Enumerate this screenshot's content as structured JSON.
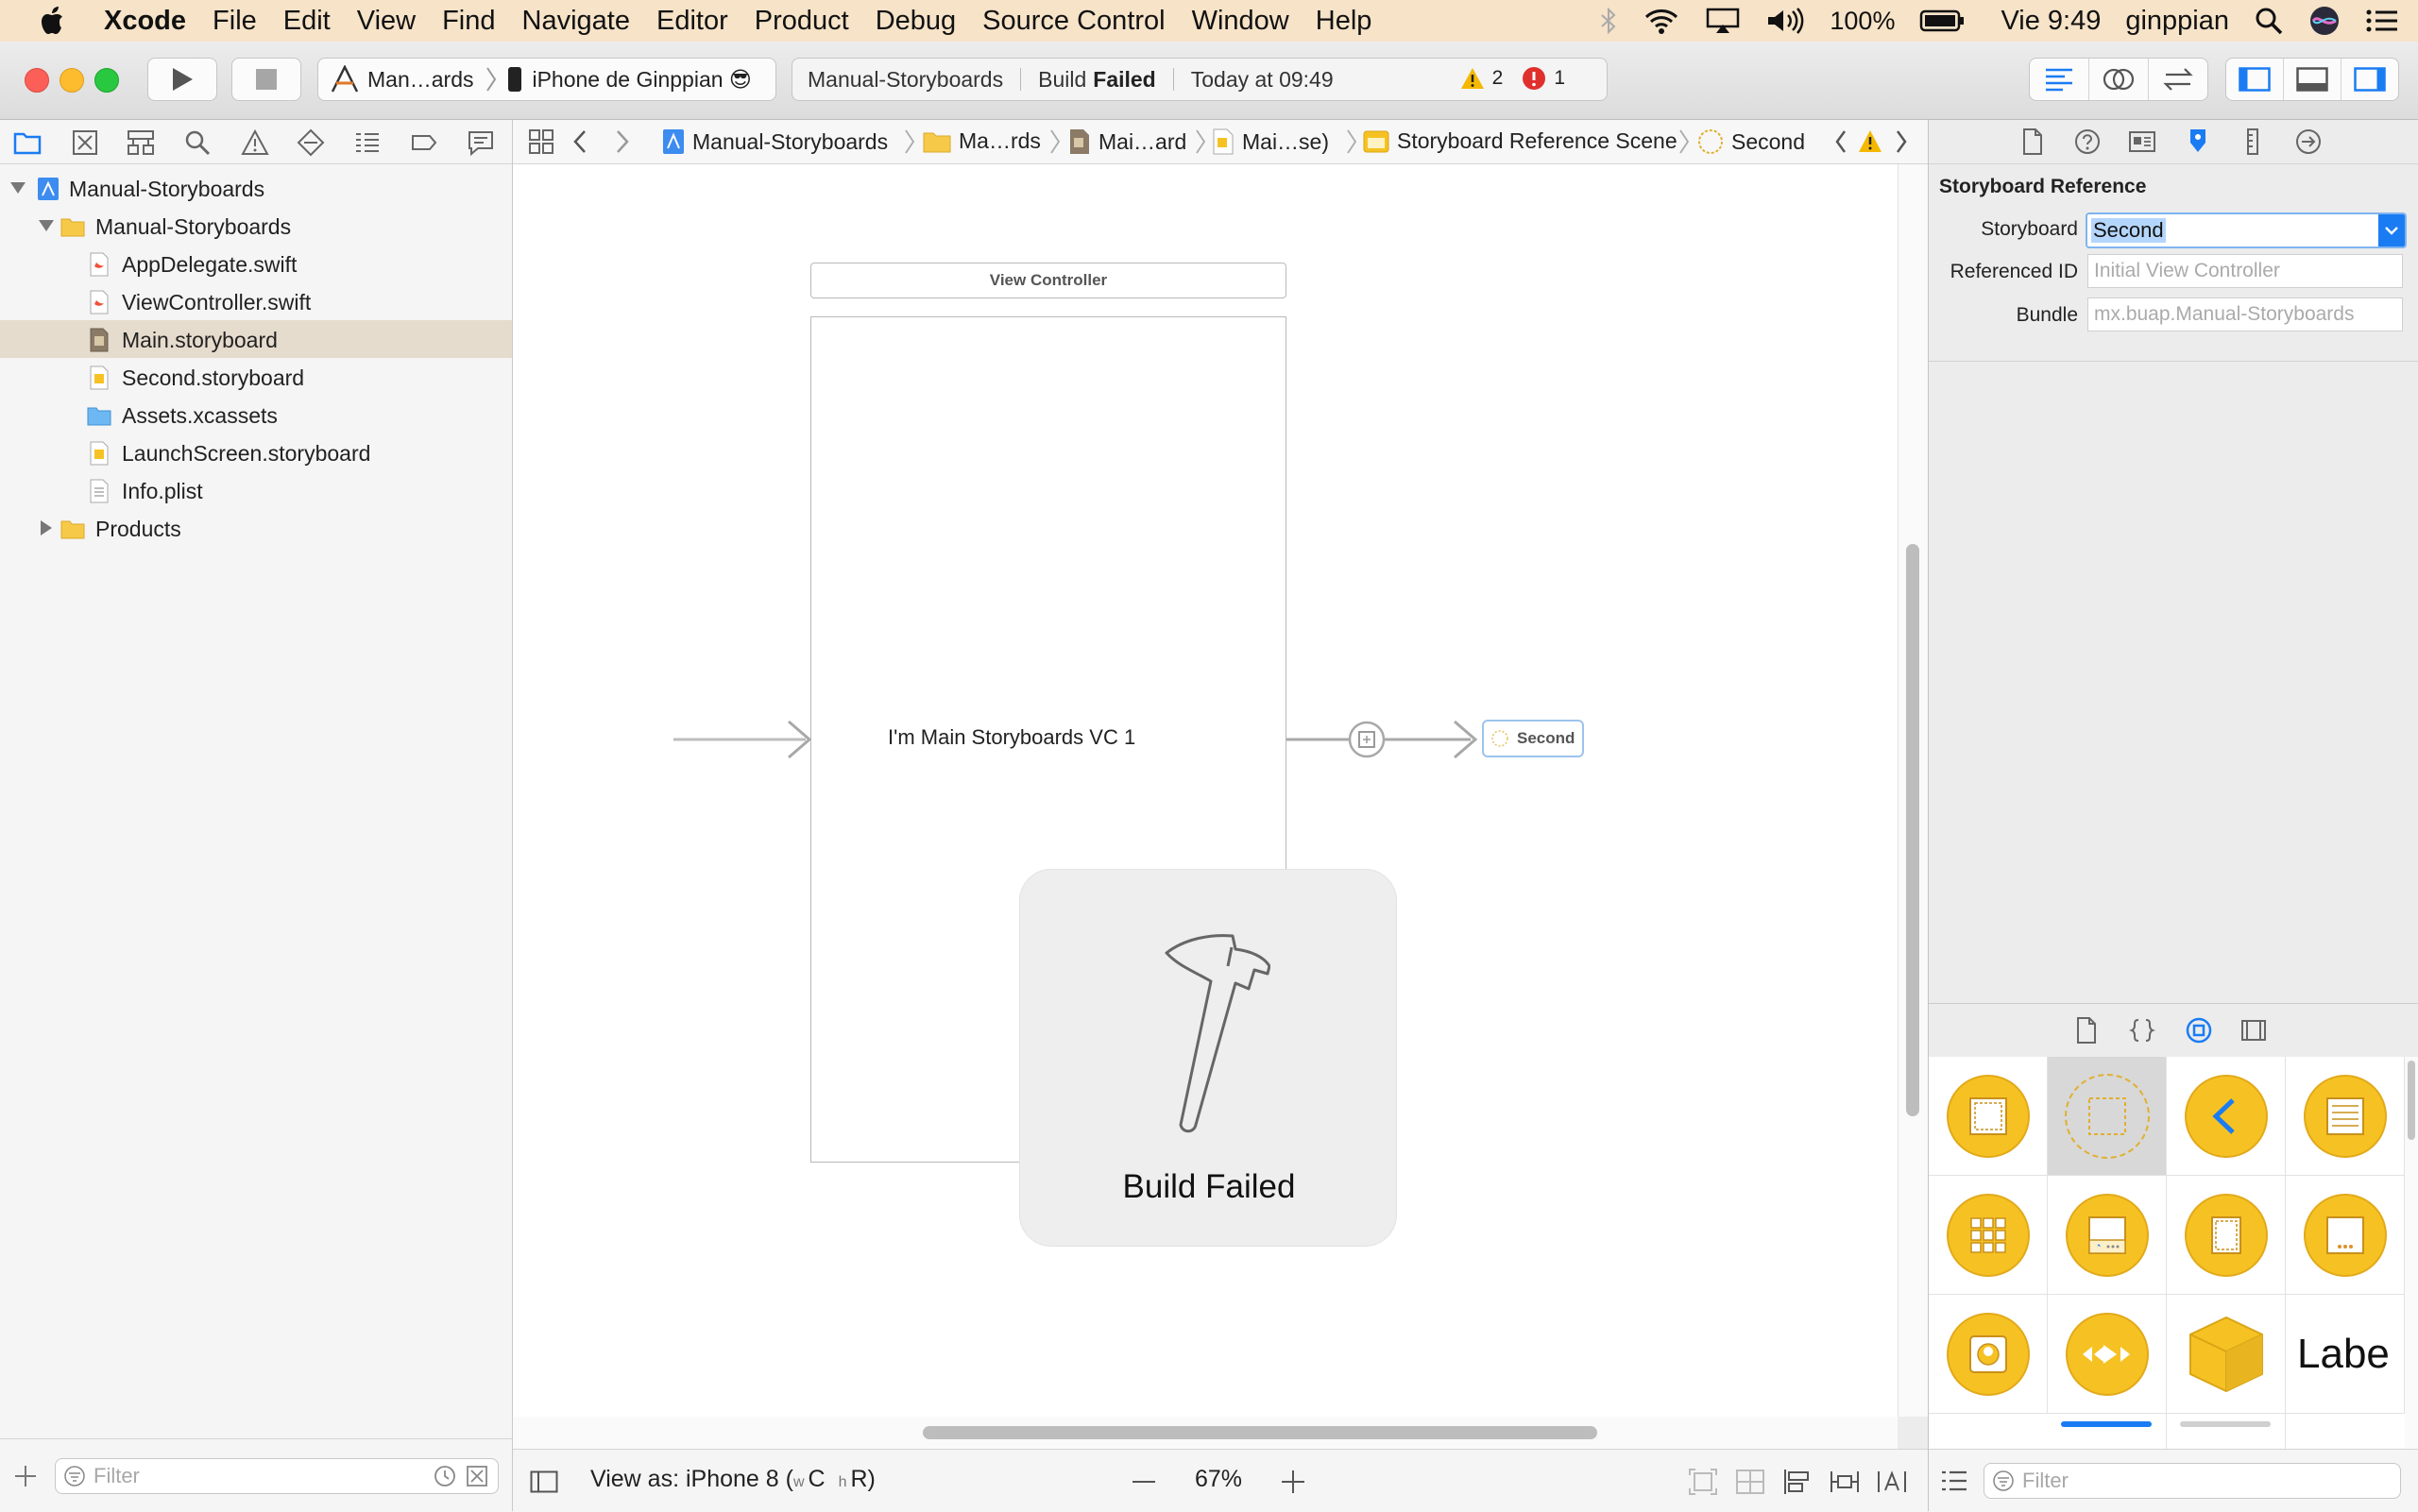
{
  "menubar": {
    "app_name": "Xcode",
    "items": [
      "File",
      "Edit",
      "View",
      "Find",
      "Navigate",
      "Editor",
      "Product",
      "Debug",
      "Source Control",
      "Window",
      "Help"
    ],
    "battery": "100%",
    "clock": "Vie 9:49",
    "user": "ginppian"
  },
  "toolbar": {
    "scheme_name": "Man…ards",
    "device_name": "iPhone de Ginppian 😎",
    "activity_project": "Manual-Storyboards",
    "activity_build": "Build",
    "activity_status": "Failed",
    "activity_time": "Today at 09:49",
    "warning_count": "2",
    "error_count": "1"
  },
  "navigator": {
    "items": [
      {
        "label": "Manual-Storyboards"
      },
      {
        "label": "Manual-Storyboards"
      },
      {
        "label": "AppDelegate.swift"
      },
      {
        "label": "ViewController.swift"
      },
      {
        "label": "Main.storyboard"
      },
      {
        "label": "Second.storyboard"
      },
      {
        "label": "Assets.xcassets"
      },
      {
        "label": "LaunchScreen.storyboard"
      },
      {
        "label": "Info.plist"
      },
      {
        "label": "Products"
      }
    ],
    "filter_placeholder": "Filter"
  },
  "jumpbar": {
    "crumbs": [
      "Manual-Storyboards",
      "Ma…rds",
      "Mai…ard",
      "Mai…se)",
      "Storyboard Reference Scene",
      "Second"
    ]
  },
  "canvas": {
    "vc_title": "View Controller",
    "vc_label": "I'm Main Storyboards VC 1",
    "reference_label": "Second",
    "hud_text": "Build Failed"
  },
  "editor_bottom": {
    "view_as_prefix": "View as: iPhone 8 (",
    "w_small": "w",
    "w_class": "C",
    "h_small": "h",
    "h_class": "R",
    "view_as_suffix": ")",
    "zoom": "67%"
  },
  "inspector": {
    "section_title": "Storyboard Reference",
    "storyboard_label": "Storyboard",
    "storyboard_value": "Second",
    "referenced_id_label": "Referenced ID",
    "referenced_id_placeholder": "Initial View Controller",
    "bundle_label": "Bundle",
    "bundle_placeholder": "mx.buap.Manual-Storyboards"
  },
  "library": {
    "label_item": "Labe",
    "filter_placeholder": "Filter"
  },
  "colors": {
    "accent": "#1a7cf3",
    "menubar_bg": "#f6e3c8",
    "error": "#e0302e",
    "warning": "#f5b800",
    "library_yellow": "#f6c223"
  }
}
